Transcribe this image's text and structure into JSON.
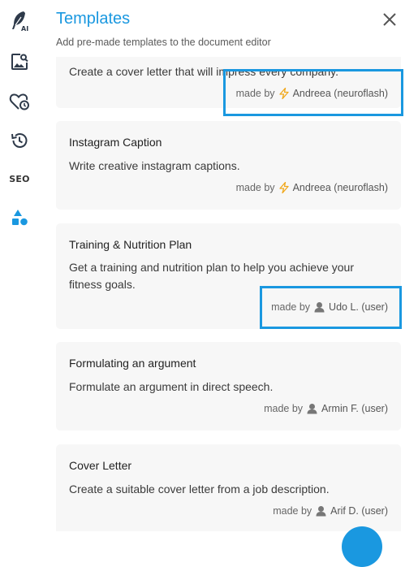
{
  "rail": {
    "items": [
      {
        "name": "ai-writer-icon",
        "label": "AI"
      },
      {
        "name": "image-search-icon"
      },
      {
        "name": "favorites-icon"
      },
      {
        "name": "history-icon"
      },
      {
        "name": "seo-icon",
        "label": "SEO"
      },
      {
        "name": "templates-icon",
        "active": true
      }
    ]
  },
  "header": {
    "title": "Templates",
    "subtitle": "Add pre-made templates to the document editor"
  },
  "templates": [
    {
      "title": "",
      "description": "Create a cover letter that will impress every company.",
      "made_by_label": "made by",
      "author": "Andreea (neuroflash)",
      "author_type": "neuroflash"
    },
    {
      "title": "Instagram Caption",
      "description": "Write creative instagram captions.",
      "made_by_label": "made by",
      "author": "Andreea (neuroflash)",
      "author_type": "neuroflash"
    },
    {
      "title": "Training & Nutrition Plan",
      "description": "Get a training and nutrition plan to help you achieve your fitness goals.",
      "made_by_label": "made by",
      "author": "Udo L. (user)",
      "author_type": "user"
    },
    {
      "title": "Formulating an argument",
      "description": "Formulate an argument in direct speech.",
      "made_by_label": "made by",
      "author": "Armin F. (user)",
      "author_type": "user"
    },
    {
      "title": "Cover Letter",
      "description": "Create a suitable cover letter from a job description.",
      "made_by_label": "made by",
      "author": "Arif D. (user)",
      "author_type": "user"
    }
  ],
  "colors": {
    "accent": "#1a98e0",
    "card_bg": "#f7f7f7",
    "bolt": "#f0a81c"
  }
}
